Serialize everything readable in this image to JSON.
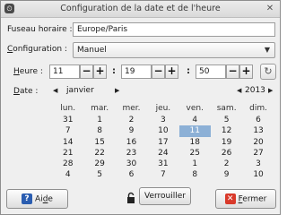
{
  "window": {
    "title": "Configuration de la date et de l'heure"
  },
  "timezone": {
    "label": "Fuseau horaire :",
    "value": "Europe/Paris"
  },
  "configuration": {
    "label_underlined": "C",
    "label_rest": "onfiguration :",
    "selected": "Manuel"
  },
  "time": {
    "label_underlined": "H",
    "label_rest": "eure :",
    "hour": "11",
    "minute": "19",
    "second": "50",
    "separator": ":"
  },
  "date": {
    "label_underlined": "D",
    "label_rest": "ate :",
    "month": "janvier",
    "year": "2013",
    "weekdays": [
      "lun.",
      "mar.",
      "mer.",
      "jeu.",
      "ven.",
      "sam.",
      "dim."
    ],
    "weeks": [
      [
        "31",
        "1",
        "2",
        "3",
        "4",
        "5",
        "6"
      ],
      [
        "7",
        "8",
        "9",
        "10",
        "11",
        "12",
        "13"
      ],
      [
        "14",
        "15",
        "16",
        "17",
        "18",
        "19",
        "20"
      ],
      [
        "21",
        "22",
        "23",
        "24",
        "25",
        "26",
        "27"
      ],
      [
        "28",
        "29",
        "30",
        "31",
        "1",
        "2",
        "3"
      ],
      [
        "4",
        "5",
        "6",
        "7",
        "8",
        "9",
        "10"
      ]
    ],
    "selected_day": "11"
  },
  "buttons": {
    "help_pre": "Ai",
    "help_u": "d",
    "help_post": "e",
    "lock": "Verrouiller",
    "close_u": "F",
    "close_rest": "ermer"
  },
  "colors": {
    "selection": "#8cb0d6",
    "help_icon": "#2a5db0",
    "close_icon": "#d93a2b"
  }
}
